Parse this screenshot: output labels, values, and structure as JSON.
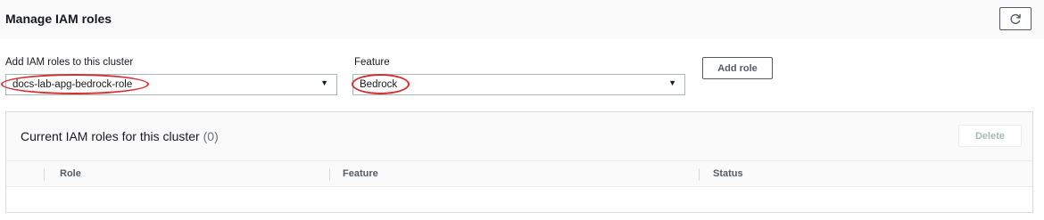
{
  "header": {
    "title": "Manage IAM roles",
    "refresh_icon": "refresh-icon"
  },
  "form": {
    "role_label": "Add IAM roles to this cluster",
    "role_value": "docs-lab-apg-bedrock-role",
    "feature_label": "Feature",
    "feature_value": "Bedrock",
    "add_role_label": "Add role",
    "dropdown_icon": "caret-down-icon",
    "highlight_color": "#d62e2e"
  },
  "current_roles": {
    "title": "Current IAM roles for this cluster",
    "count": "(0)",
    "delete_label": "Delete",
    "columns": [
      "Role",
      "Feature",
      "Status"
    ]
  }
}
